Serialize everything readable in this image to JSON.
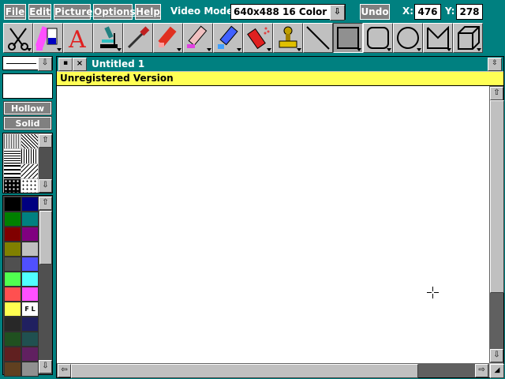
{
  "menu": {
    "file": "File",
    "edit": "Edit",
    "picture": "Picture",
    "options": "Options",
    "help": "Help"
  },
  "video_mode": {
    "label": "Video Mode:",
    "value": "640x488 16 Color"
  },
  "undo": "Undo",
  "coords": {
    "x_label": "X:",
    "x_value": "476",
    "y_label": "Y:",
    "y_value": "278"
  },
  "tools": [
    "scissors-icon",
    "fill-brush-icon",
    "text-icon",
    "microscope-icon",
    "eyedropper-icon",
    "marker-icon",
    "eraser-icon",
    "paint-bottle-icon",
    "spray-can-icon",
    "stamp-icon",
    "line-icon",
    "rectangle-filled-icon",
    "rounded-rectangle-icon",
    "ellipse-icon",
    "polygon-icon",
    "cube-icon"
  ],
  "palette_panel": {
    "hollow": "Hollow",
    "solid": "Solid",
    "fl_label": "F L"
  },
  "document": {
    "title": "Untitled 1",
    "banner": "Unregistered Version"
  },
  "colors": {
    "desktop": "#008080",
    "banner_bg": "#ffff55",
    "title_bar": "#008080",
    "palette": [
      "#000000",
      "#000080",
      "#008000",
      "#008080",
      "#800000",
      "#800080",
      "#808000",
      "#c0c0c0",
      "#505050",
      "#5050ff",
      "#50ff50",
      "#50ffff",
      "#ff5050",
      "#ff50ff",
      "#ffff50",
      "#ffffff",
      "#282828",
      "#202060",
      "#205020",
      "#205050",
      "#602020",
      "#602060",
      "#604020",
      "#909090"
    ]
  }
}
